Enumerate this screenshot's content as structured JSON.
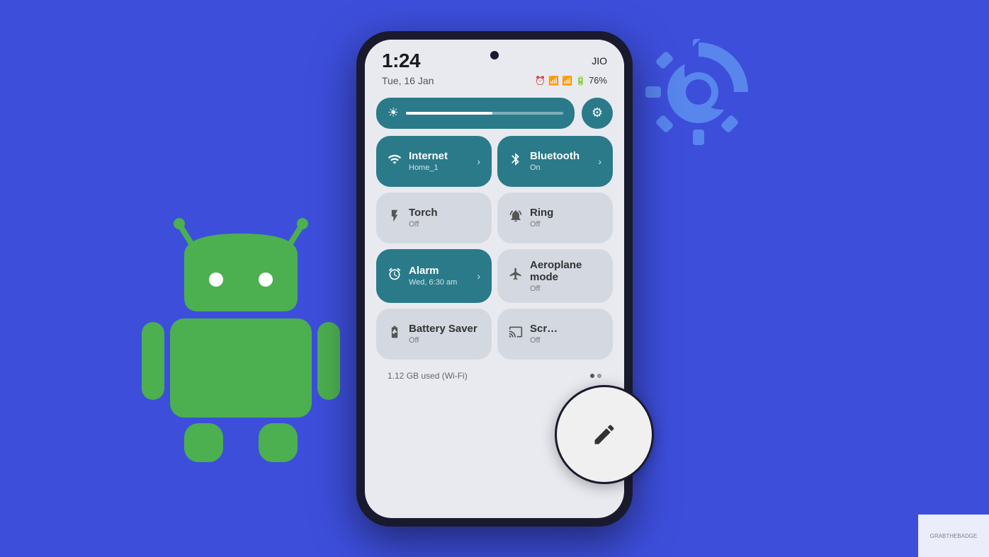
{
  "background": {
    "color": "#3d4edb"
  },
  "phone": {
    "status_bar": {
      "time": "1:24",
      "carrier": "JIO",
      "date": "Tue, 16 Jan",
      "battery_percent": "76%",
      "battery_level": 76
    },
    "brightness": {
      "fill_percent": 55
    },
    "settings_icon": "⚙",
    "tiles": [
      {
        "id": "internet",
        "label": "Internet",
        "sublabel": "Home_1",
        "icon": "wifi",
        "active": true,
        "has_chevron": true
      },
      {
        "id": "bluetooth",
        "label": "Bluetooth",
        "sublabel": "On",
        "icon": "bluetooth",
        "active": true,
        "has_chevron": true
      },
      {
        "id": "torch",
        "label": "Torch",
        "sublabel": "Off",
        "icon": "torch",
        "active": false,
        "has_chevron": false
      },
      {
        "id": "ring",
        "label": "Ring",
        "sublabel": "Off",
        "icon": "bell",
        "active": false,
        "has_chevron": false
      },
      {
        "id": "alarm",
        "label": "Alarm",
        "sublabel": "Wed, 6:30 am",
        "icon": "alarm",
        "active": true,
        "has_chevron": true
      },
      {
        "id": "aeroplane",
        "label": "Aeroplane mode",
        "sublabel": "Off",
        "icon": "plane",
        "active": false,
        "has_chevron": false
      },
      {
        "id": "battery",
        "label": "Battery Saver",
        "sublabel": "Off",
        "icon": "battery",
        "active": false,
        "has_chevron": false
      },
      {
        "id": "screen",
        "label": "Screen",
        "sublabel": "Off",
        "icon": "cast",
        "active": false,
        "has_chevron": false
      }
    ],
    "data_usage": "1.12 GB used (Wi-Fi)",
    "edit_button_label": "✏"
  },
  "watermark": {
    "text": "GRABTHEBADGE"
  }
}
